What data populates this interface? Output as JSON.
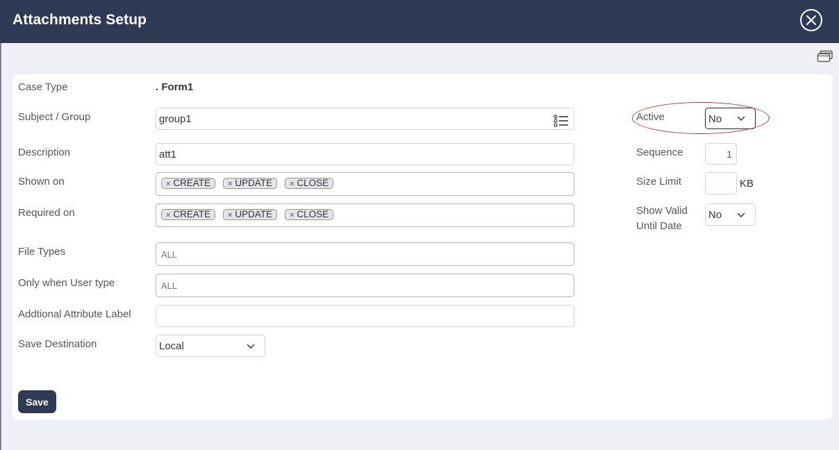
{
  "dialog": {
    "title": "Attachments Setup"
  },
  "icons": {
    "close": "close-circle-icon",
    "window": "window-restore-icon",
    "list": "list-icon",
    "chevron": "chevron-down-icon",
    "tag_remove": "x-icon"
  },
  "form": {
    "case_type": {
      "label": "Case Type",
      "value": ". Form1"
    },
    "subject_group": {
      "label": "Subject / Group",
      "value": "group1"
    },
    "description": {
      "label": "Description",
      "value": "att1"
    },
    "shown_on": {
      "label": "Shown on",
      "tags": [
        "CREATE",
        "UPDATE",
        "CLOSE"
      ]
    },
    "required_on": {
      "label": "Required on",
      "tags": [
        "CREATE",
        "UPDATE",
        "CLOSE"
      ]
    },
    "file_types": {
      "label": "File Types",
      "placeholder": "ALL"
    },
    "user_type": {
      "label": "Only when User type",
      "placeholder": "ALL"
    },
    "attr_label": {
      "label": "Addtional Attribute Label",
      "value": ""
    },
    "save_destination": {
      "label": "Save Destination",
      "value": "Local"
    },
    "active": {
      "label": "Active",
      "value": "No"
    },
    "sequence": {
      "label": "Sequence",
      "value": "1"
    },
    "size_limit": {
      "label": "Size Limit",
      "unit": "KB",
      "value": ""
    },
    "show_valid": {
      "label_line1": "Show Valid",
      "label_line2": "Until Date",
      "value": "No"
    }
  },
  "actions": {
    "save_label": "Save"
  },
  "colors": {
    "header": "#2f3b55",
    "highlight": "#c8323a"
  }
}
